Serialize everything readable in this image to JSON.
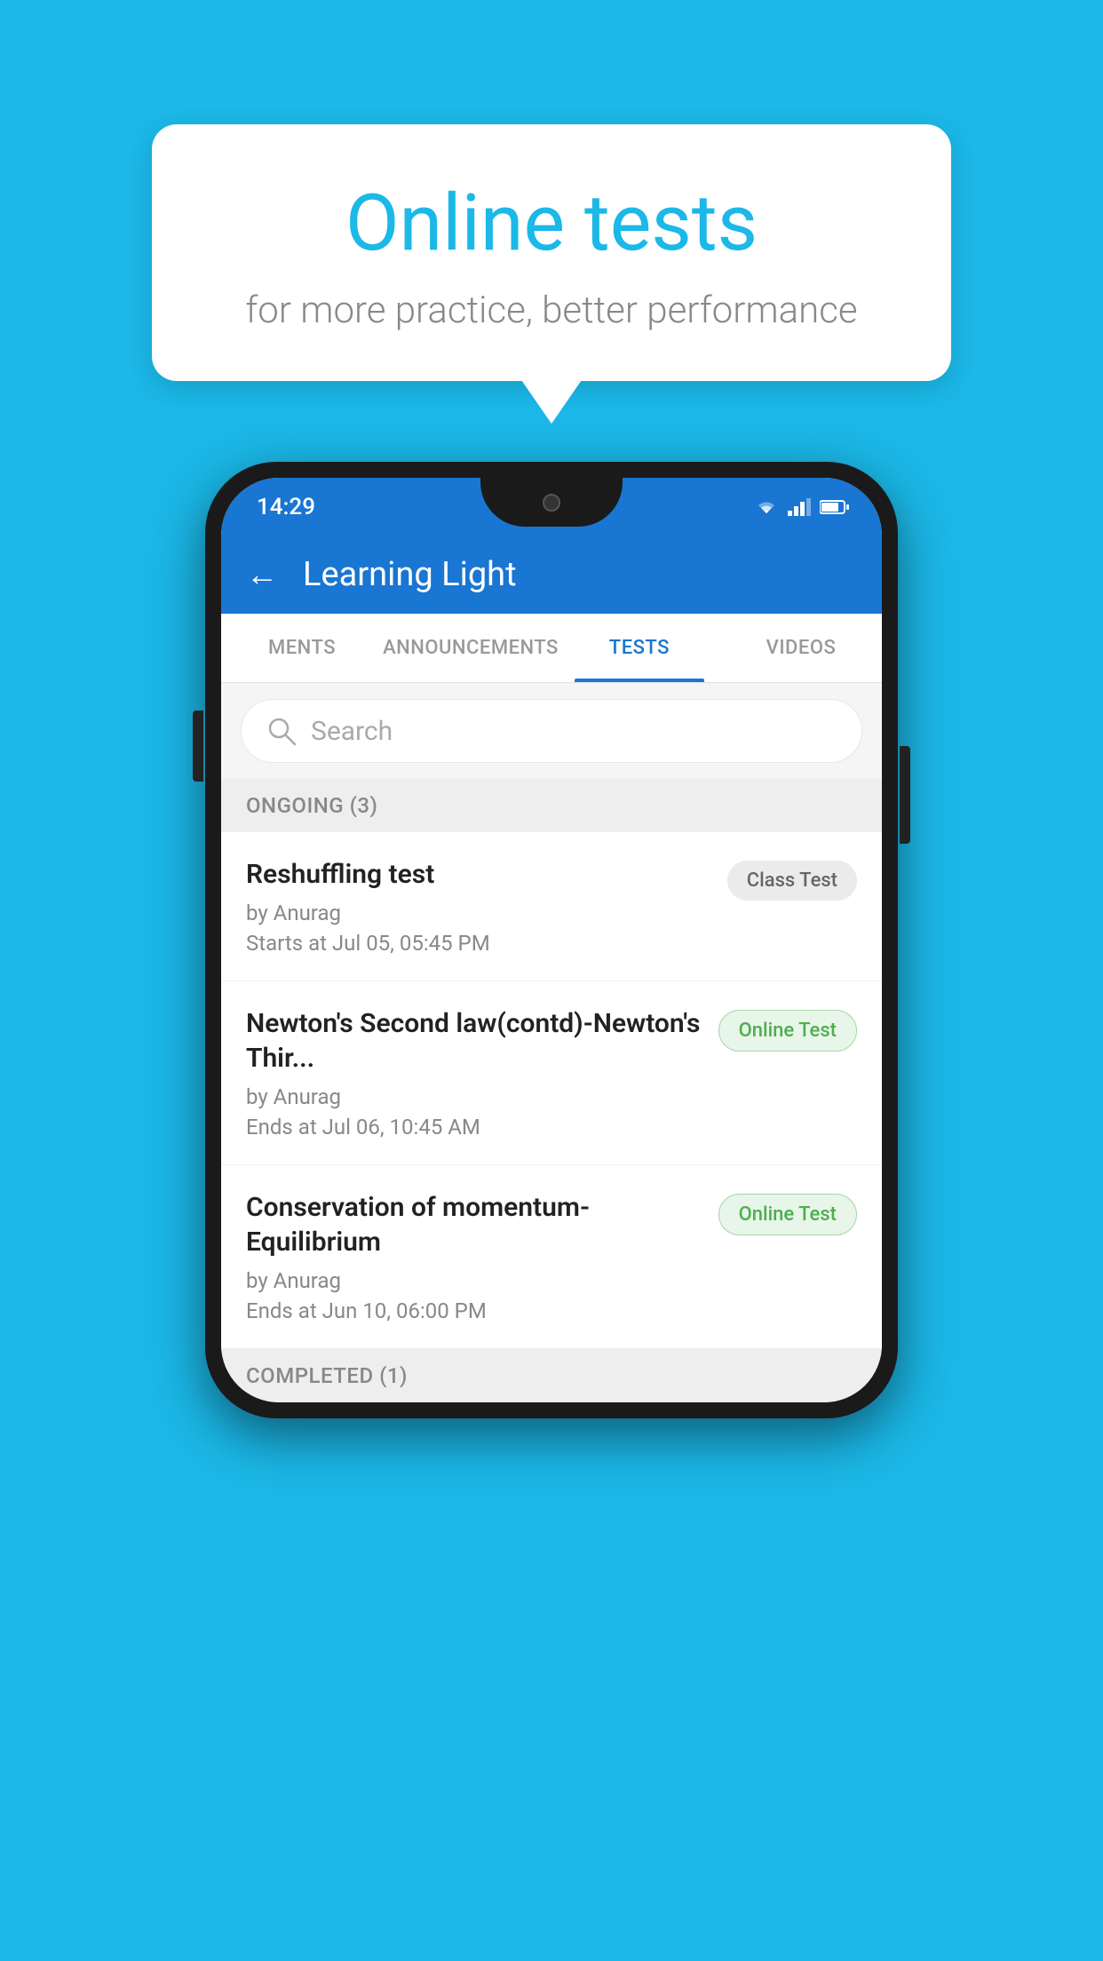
{
  "page": {
    "background_color": "#1BB8E8"
  },
  "bubble": {
    "title": "Online tests",
    "subtitle": "for more practice, better performance"
  },
  "phone": {
    "status_bar": {
      "time": "14:29"
    },
    "header": {
      "back_label": "←",
      "title": "Learning Light"
    },
    "tabs": [
      {
        "label": "MENTS",
        "active": false
      },
      {
        "label": "ANNOUNCEMENTS",
        "active": false
      },
      {
        "label": "TESTS",
        "active": true
      },
      {
        "label": "VIDEOS",
        "active": false
      }
    ],
    "search": {
      "placeholder": "Search"
    },
    "ongoing_section": {
      "label": "ONGOING (3)"
    },
    "tests": [
      {
        "name": "Reshuffling test",
        "by": "by Anurag",
        "time": "Starts at  Jul 05, 05:45 PM",
        "badge": "Class Test",
        "badge_type": "class"
      },
      {
        "name": "Newton's Second law(contd)-Newton's Thir...",
        "by": "by Anurag",
        "time": "Ends at  Jul 06, 10:45 AM",
        "badge": "Online Test",
        "badge_type": "online"
      },
      {
        "name": "Conservation of momentum-Equilibrium",
        "by": "by Anurag",
        "time": "Ends at  Jun 10, 06:00 PM",
        "badge": "Online Test",
        "badge_type": "online"
      }
    ],
    "completed_section": {
      "label": "COMPLETED (1)"
    }
  }
}
